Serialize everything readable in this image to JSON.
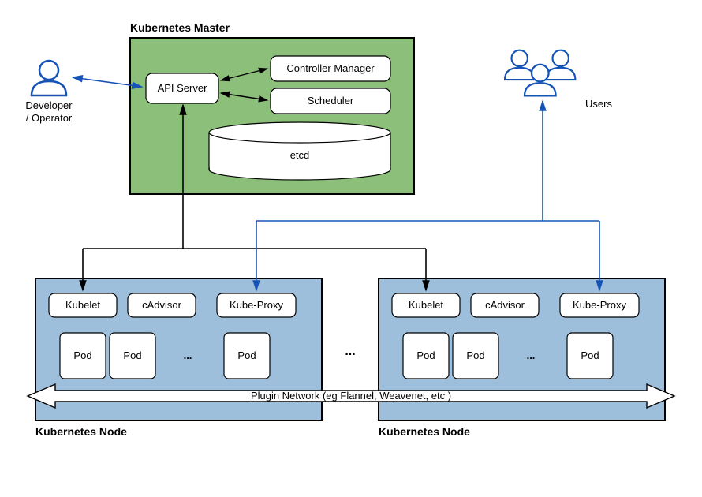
{
  "master": {
    "title": "Kubernetes Master",
    "api_server": "API Server",
    "controller_manager": "Controller Manager",
    "scheduler": "Scheduler",
    "etcd": "etcd"
  },
  "developer": {
    "label_line1": "Developer",
    "label_line2": "/ Operator"
  },
  "users": {
    "label": "Users"
  },
  "node1": {
    "title": "Kubernetes Node",
    "kubelet": "Kubelet",
    "cadvisor": "cAdvisor",
    "kubeproxy": "Kube-Proxy",
    "pod": "Pod",
    "ellipsis": "..."
  },
  "node2": {
    "title": "Kubernetes Node",
    "kubelet": "Kubelet",
    "cadvisor": "cAdvisor",
    "kubeproxy": "Kube-Proxy",
    "pod": "Pod",
    "ellipsis": "..."
  },
  "between_nodes_ellipsis": "...",
  "network_bar": "Plugin Network (eg Flannel, Weavenet, etc )"
}
